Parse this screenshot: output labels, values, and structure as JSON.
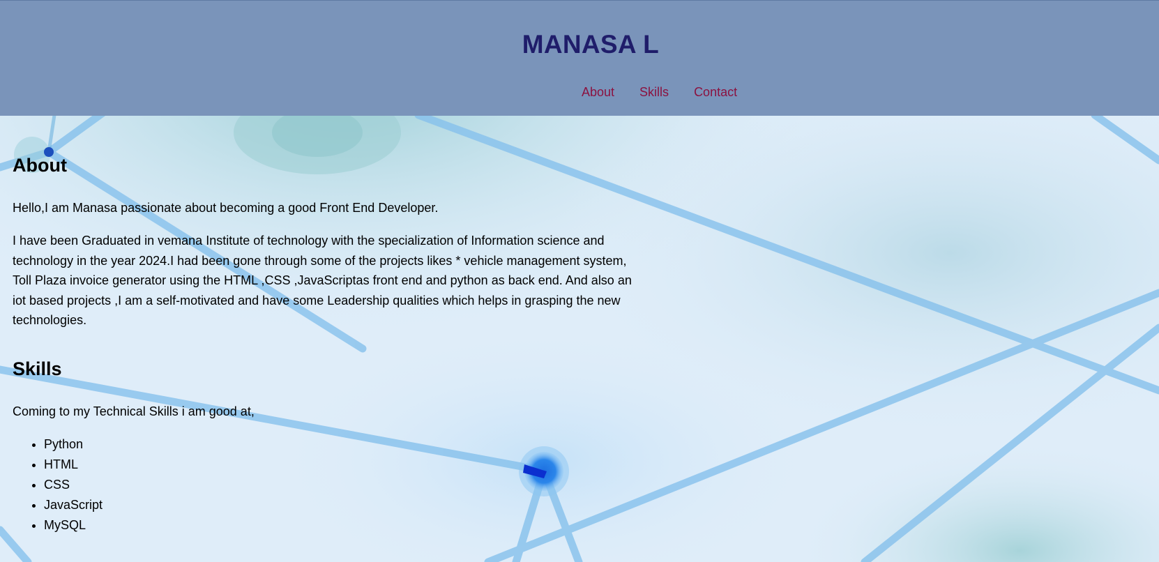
{
  "header": {
    "title": "MANASA L",
    "nav": [
      {
        "label": "About"
      },
      {
        "label": "Skills"
      },
      {
        "label": "Contact"
      }
    ]
  },
  "about": {
    "heading": "About",
    "intro": "Hello,I am Manasa passionate about becoming a good Front End Developer.",
    "body": "I have been Graduated in vemana Institute of technology with the specialization of Information science and technology in the year 2024.I had been gone through some of the projects likes * vehicle management system, Toll Plaza invoice generator using the HTML ,CSS ,JavaScriptas front end and python as back end. And also an iot based projects ,I am a self-motivated and have some Leadership qualities which helps in grasping the new technologies."
  },
  "skills": {
    "heading": "Skills",
    "intro": "Coming to my Technical Skills i am good at,",
    "items": [
      "Python",
      "HTML",
      "CSS",
      "JavaScript",
      "MySQL"
    ]
  },
  "colors": {
    "header_bg": "#7a94ba",
    "title": "#1f1d6a",
    "nav_link": "#8b1240",
    "page_bg": "#e1eefa"
  }
}
